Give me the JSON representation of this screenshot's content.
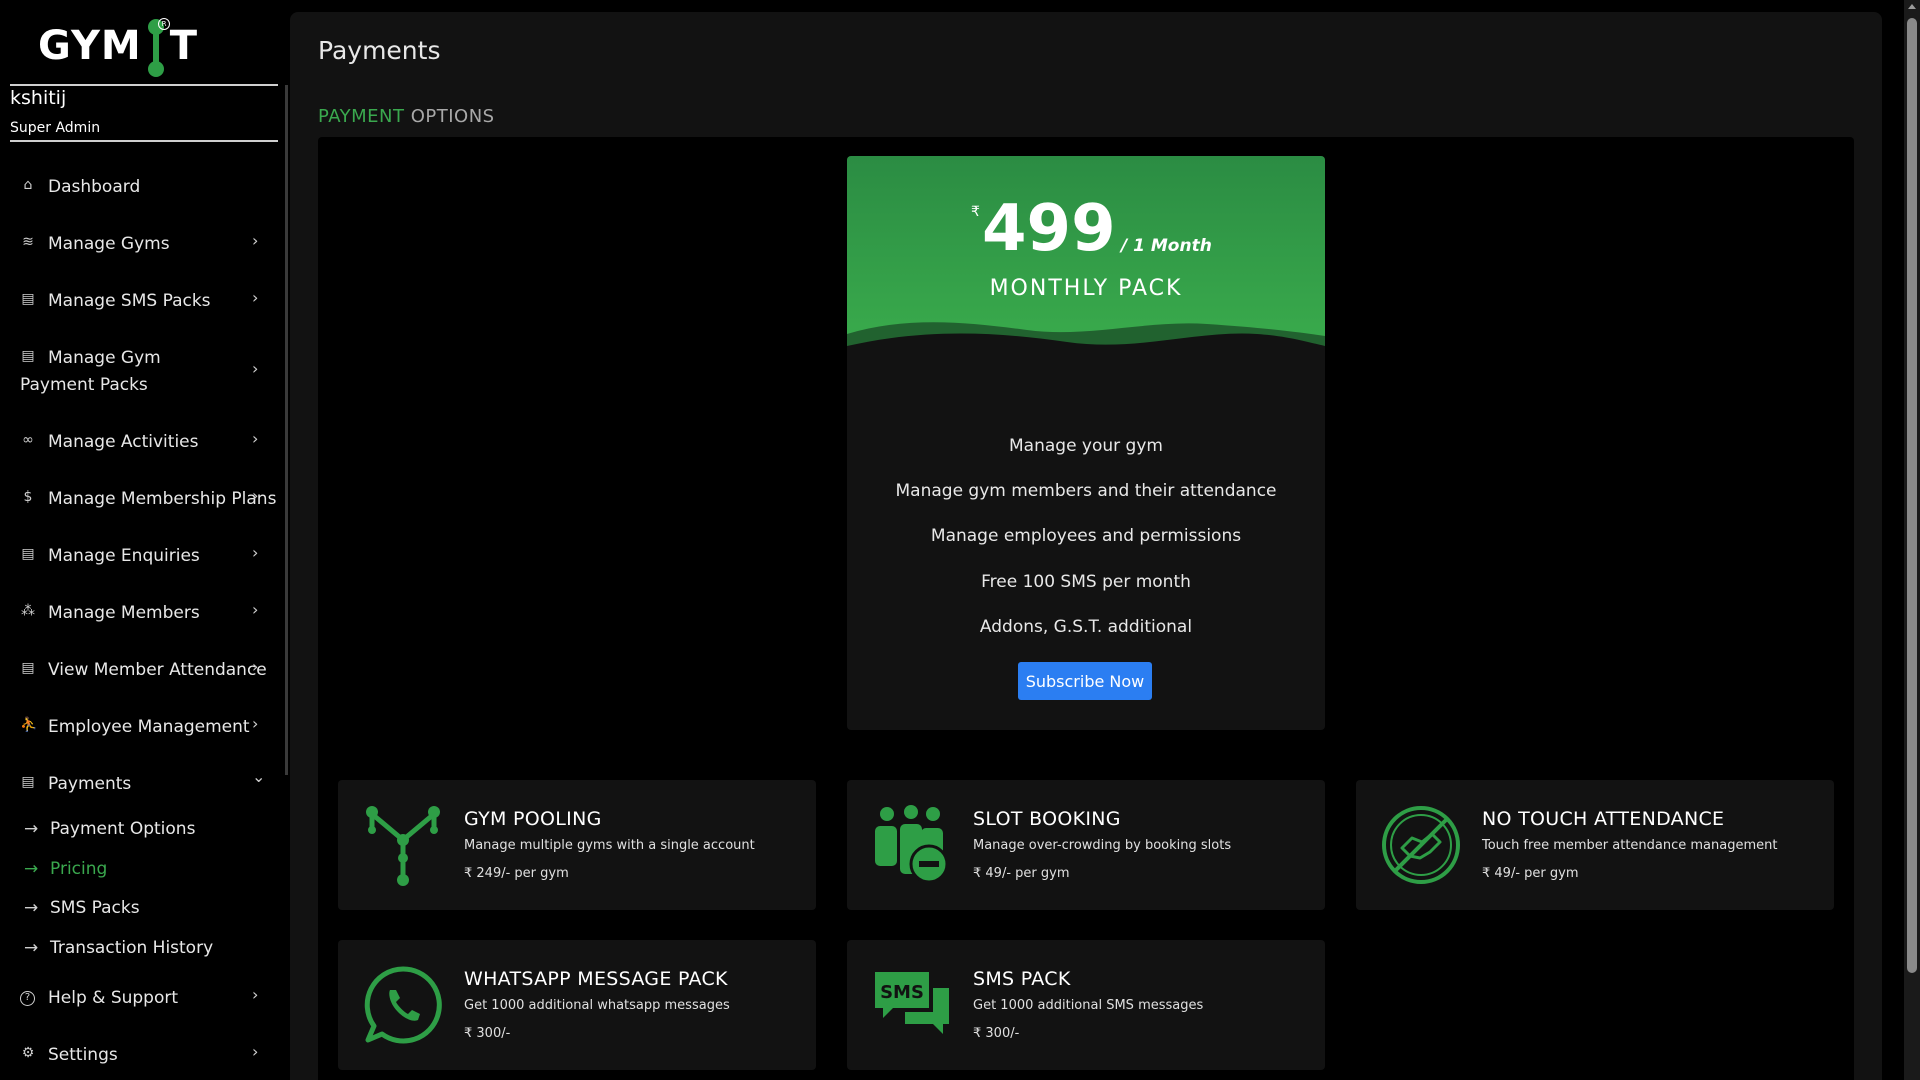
{
  "app": {
    "logo_text_left": "GYM",
    "logo_text_right": "T",
    "logo_reg": "R"
  },
  "user": {
    "name": "kshitij",
    "role": "Super Admin"
  },
  "sidebar": {
    "items": [
      {
        "label": "Dashboard",
        "icon": "dashboard-icon",
        "glyph": "⌂",
        "has_chevron": false
      },
      {
        "label": "Manage Gyms",
        "icon": "gym-icon",
        "glyph": "≋",
        "has_chevron": true
      },
      {
        "label": "Manage SMS Packs",
        "icon": "sms-icon",
        "glyph": "▤",
        "has_chevron": true
      },
      {
        "label": "Manage Gym Payment Packs",
        "icon": "payment-pack-icon",
        "glyph": "▤",
        "has_chevron": true
      },
      {
        "label": "Manage Activities",
        "icon": "activities-icon",
        "glyph": "∞",
        "has_chevron": true
      },
      {
        "label": "Manage Membership Plans",
        "icon": "dollar-icon",
        "glyph": "$",
        "has_chevron": true
      },
      {
        "label": "Manage Enquiries",
        "icon": "enquiries-icon",
        "glyph": "▤",
        "has_chevron": true
      },
      {
        "label": "Manage Members",
        "icon": "members-icon",
        "glyph": "⁂",
        "has_chevron": true
      },
      {
        "label": "View Member Attendance",
        "icon": "attendance-icon",
        "glyph": "▤",
        "has_chevron": true
      },
      {
        "label": "Employee Management",
        "icon": "employee-icon",
        "glyph": "⛹",
        "has_chevron": true
      },
      {
        "label": "Payments",
        "icon": "payments-icon",
        "glyph": "▤",
        "has_chevron": true
      }
    ],
    "payments_sub": [
      {
        "label": "Payment Options",
        "active": false
      },
      {
        "label": "Pricing",
        "active": true
      },
      {
        "label": "SMS Packs",
        "active": false
      },
      {
        "label": "Transaction History",
        "active": false
      }
    ],
    "bottom_items": [
      {
        "label": "Help & Support",
        "icon": "help-icon",
        "glyph": "?"
      },
      {
        "label": "Settings",
        "icon": "settings-icon",
        "glyph": "⚙"
      }
    ],
    "chevron_right": "›",
    "chevron_down": "⌄",
    "sub_arrow": "→"
  },
  "main": {
    "title": "Payments",
    "section_title_green": "PAYMENT",
    "section_title_rest": " OPTIONS"
  },
  "pricing_card": {
    "currency": "₹",
    "amount": "499",
    "period": "/ 1 Month",
    "pack_name": "MONTHLY PACK",
    "features": [
      "Manage your gym",
      "Manage gym members and their attendance",
      "Manage employees and permissions",
      "Free 100 SMS per month",
      "Addons, G.S.T. additional"
    ],
    "button_label": "Subscribe Now",
    "accent": "#3eb54f",
    "button_color": "#2b7ef2"
  },
  "addons": [
    {
      "title": "GYM POOLING",
      "desc": "Manage multiple gyms with a single account",
      "price": "₹ 249/- per gym",
      "icon": "gym-pooling-icon"
    },
    {
      "title": "SLOT BOOKING",
      "desc": "Manage over-crowding by booking slots",
      "price": "₹ 49/- per gym",
      "icon": "slot-booking-icon"
    },
    {
      "title": "NO TOUCH ATTENDANCE",
      "desc": "Touch free member attendance management",
      "price": "₹ 49/- per gym",
      "icon": "no-touch-icon"
    },
    {
      "title": "WHATSAPP MESSAGE PACK",
      "desc": "Get 1000 additional whatsapp messages",
      "price": "₹ 300/-",
      "icon": "whatsapp-icon"
    },
    {
      "title": "SMS PACK",
      "desc": "Get 1000 additional SMS messages",
      "price": "₹ 300/-",
      "icon": "sms-pack-icon"
    }
  ],
  "icon_green": "#2e9e46"
}
